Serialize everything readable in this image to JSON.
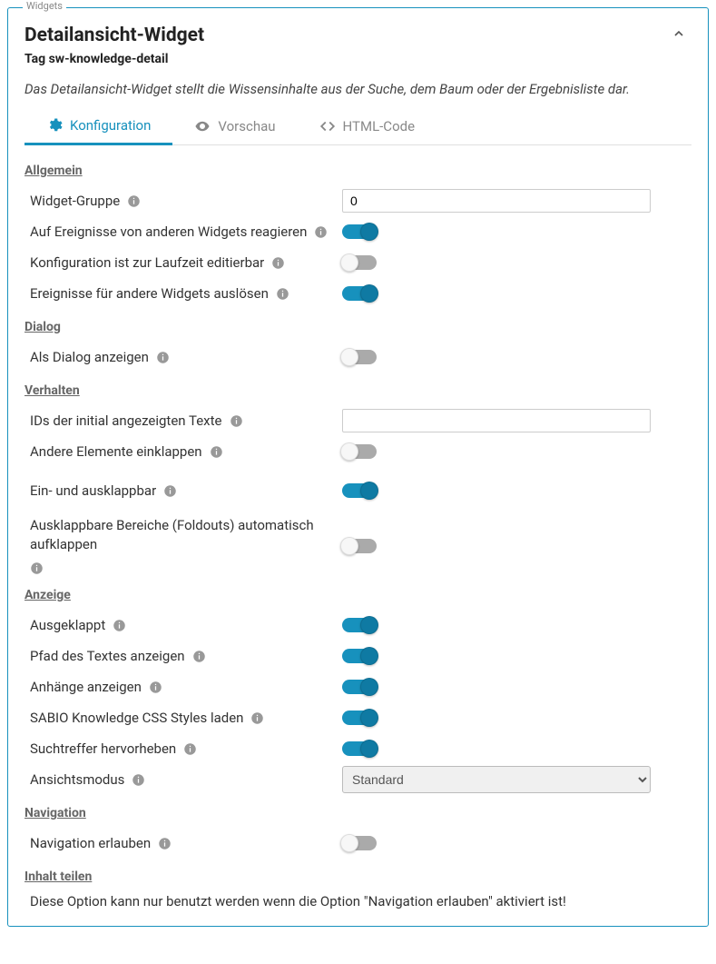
{
  "panel_legend": "Widgets",
  "title": "Detailansicht-Widget",
  "subtitle": "Tag sw-knowledge-detail",
  "description": "Das Detailansicht-Widget stellt die Wissensinhalte aus der Suche, dem Baum oder der Ergebnisliste dar.",
  "tabs": {
    "konfiguration": "Konfiguration",
    "vorschau": "Vorschau",
    "htmlcode": "HTML-Code"
  },
  "sections": {
    "allgemein": "Allgemein",
    "dialog": "Dialog",
    "verhalten": "Verhalten",
    "anzeige": "Anzeige",
    "navigation": "Navigation",
    "inhalt_teilen": "Inhalt teilen"
  },
  "fields": {
    "widget_gruppe": {
      "label": "Widget-Gruppe",
      "value": "0"
    },
    "auf_ereignisse": {
      "label": "Auf Ereignisse von anderen Widgets reagieren",
      "on": true
    },
    "konfig_laufzeit": {
      "label": "Konfiguration ist zur Laufzeit editierbar",
      "on": false
    },
    "ereignisse_ausloesen": {
      "label": "Ereignisse für andere Widgets auslösen",
      "on": true
    },
    "als_dialog": {
      "label": "Als Dialog anzeigen",
      "on": false
    },
    "ids_initial": {
      "label": "IDs der initial angezeigten Texte",
      "value": ""
    },
    "andere_einklappen": {
      "label": "Andere Elemente einklappen",
      "on": false
    },
    "ein_ausklappbar": {
      "label": "Ein- und ausklappbar",
      "on": true
    },
    "foldouts_auto": {
      "label": "Ausklappbare Bereiche (Foldouts) automatisch aufklappen",
      "on": false
    },
    "ausgeklappt": {
      "label": "Ausgeklappt",
      "on": true
    },
    "pfad_text": {
      "label": "Pfad des Textes anzeigen",
      "on": true
    },
    "anhaenge": {
      "label": "Anhänge anzeigen",
      "on": true
    },
    "css_styles": {
      "label": "SABIO Knowledge CSS Styles laden",
      "on": true
    },
    "suchtreffer": {
      "label": "Suchtreffer hervorheben",
      "on": true
    },
    "ansichtsmodus": {
      "label": "Ansichtsmodus",
      "value": "Standard"
    },
    "nav_erlauben": {
      "label": "Navigation erlauben",
      "on": false
    }
  },
  "notice": "Diese Option kann nur benutzt werden wenn die Option \"Navigation erlauben\" aktiviert ist!"
}
